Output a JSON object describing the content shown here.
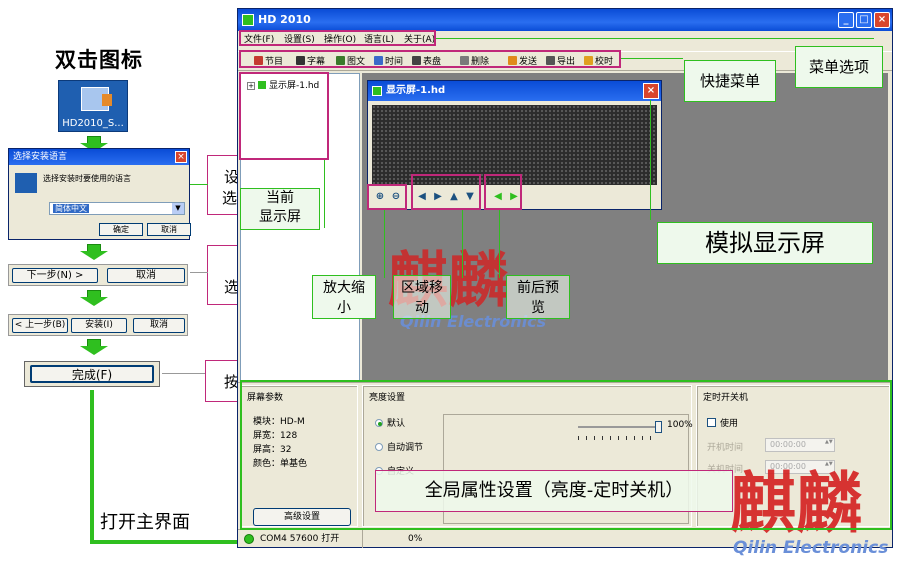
{
  "flow": {
    "heading": "双击图标",
    "app_icon_label": "HD2010_S...",
    "lang_dialog": {
      "title": "选择安装语言",
      "prompt": "选择安装时要使用的语言",
      "selected": "简体中文",
      "ok": "确定",
      "cancel": "取消"
    },
    "step2": {
      "next": "下一步(N) >",
      "cancel": "取消"
    },
    "step3": {
      "back": "< 上一步(B)",
      "install": "安装(I)",
      "cancel": "取消"
    },
    "finish": "完成(F)",
    "notes": {
      "n1a": "设",
      "n1b": "选",
      "n2": "选",
      "n3": "按"
    },
    "open_main": "打开主界面"
  },
  "window": {
    "title": "HD 2010",
    "menu": [
      "文件(F)",
      "设置(S)",
      "操作(O)",
      "语言(L)",
      "关于(A)"
    ],
    "toolbar": [
      "节目",
      "字幕",
      "图文",
      "时间",
      "表盘",
      "删除",
      "发送",
      "导出",
      "校时"
    ],
    "toolbar_colors": [
      "#c43a2f",
      "#333333",
      "#3a7a2a",
      "#3a6ac9",
      "#444444",
      "#7a7a7a",
      "#e08a1a",
      "#555555",
      "#e0a020"
    ],
    "tree_node": "显示屏-1.hd",
    "sim_window_title": "显示屏-1.hd",
    "props": {
      "screen": {
        "title": "屏幕参数",
        "module": "模块：HD-M",
        "width": "屏宽：128",
        "height": "屏高：32",
        "color": "颜色：单基色",
        "advanced": "高级设置"
      },
      "brightness": {
        "title": "亮度设置",
        "default": "默认",
        "auto": "自动调节",
        "custom": "自定义",
        "percent": "100%"
      },
      "timer": {
        "title": "定时开关机",
        "use": "使用",
        "on_label": "开机时间",
        "off_label": "关机时间",
        "on_value": "00:00:00",
        "off_value": "00:00:00"
      }
    },
    "status": {
      "port": "COM4 57600 打开",
      "progress": "0%"
    }
  },
  "annotations": {
    "menu_opts": "菜单选项",
    "quick_menu": "快捷菜单",
    "current_screen": "当前\n显示屏",
    "sim_screen": "模拟显示屏",
    "zoom": "放大缩\n小",
    "area_move": "区域移\n动",
    "preview": "前后预\n览",
    "global": "全局属性设置（亮度-定时关机）"
  },
  "watermark": {
    "cn": "麒麟",
    "en": "Qilin Electronics"
  }
}
